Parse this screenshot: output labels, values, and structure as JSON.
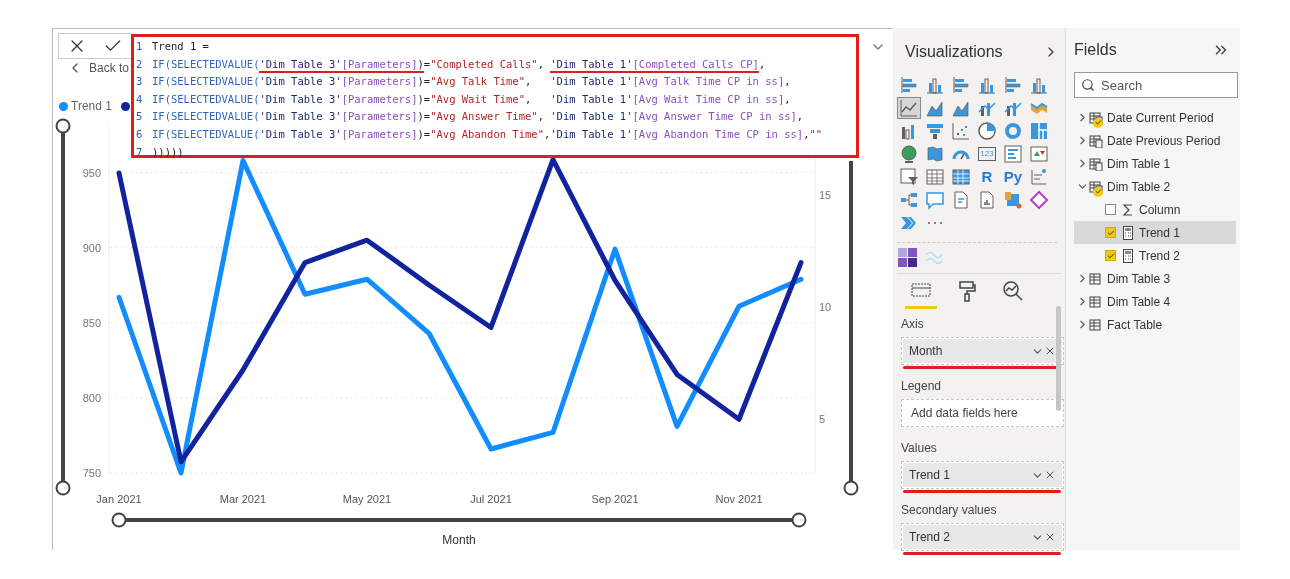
{
  "report_canvas": {
    "toolbar": {
      "back_label": "Back to"
    },
    "formula_editor": {
      "lines": [
        {
          "number": "1",
          "segments": [
            {
              "text": "Trend 1 =",
              "kind": "plain",
              "underlined": false
            }
          ]
        },
        {
          "number": "2",
          "segments": [
            {
              "text": "IF(SELECTEDVALUE(",
              "kind": "function",
              "underlined": false
            },
            {
              "text": "'Dim Table 3'",
              "kind": "table",
              "underlined": true
            },
            {
              "text": "[Parameters]",
              "kind": "column",
              "underlined": true
            },
            {
              "text": ")",
              "kind": "plain",
              "underlined": true
            },
            {
              "text": "=",
              "kind": "plain",
              "underlined": false
            },
            {
              "text": "\"Completed Calls\"",
              "kind": "string",
              "underlined": false
            },
            {
              "text": ", ",
              "kind": "plain",
              "underlined": false
            },
            {
              "text": "'Dim Table 1'",
              "kind": "table",
              "underlined": true
            },
            {
              "text": "[Completed Calls CP]",
              "kind": "column",
              "underlined": true
            },
            {
              "text": ",",
              "kind": "plain",
              "underlined": false
            }
          ]
        },
        {
          "number": "3",
          "segments": [
            {
              "text": "IF(SELECTEDVALUE(",
              "kind": "function",
              "underlined": false
            },
            {
              "text": "'Dim Table 3'",
              "kind": "table",
              "underlined": false
            },
            {
              "text": "[Parameters]",
              "kind": "column",
              "underlined": false
            },
            {
              "text": ")=",
              "kind": "plain",
              "underlined": false
            },
            {
              "text": "\"Avg Talk Time\"",
              "kind": "string",
              "underlined": false
            },
            {
              "text": ",   ",
              "kind": "plain",
              "underlined": false
            },
            {
              "text": "'Dim Table 1'",
              "kind": "table",
              "underlined": false
            },
            {
              "text": "[Avg Talk Time CP in ss]",
              "kind": "column",
              "underlined": false
            },
            {
              "text": ",",
              "kind": "plain",
              "underlined": false
            }
          ]
        },
        {
          "number": "4",
          "segments": [
            {
              "text": "IF(SELECTEDVALUE(",
              "kind": "function",
              "underlined": false
            },
            {
              "text": "'Dim Table 3'",
              "kind": "table",
              "underlined": false
            },
            {
              "text": "[Parameters]",
              "kind": "column",
              "underlined": false
            },
            {
              "text": ")=",
              "kind": "plain",
              "underlined": false
            },
            {
              "text": "\"Avg Wait Time\"",
              "kind": "string",
              "underlined": false
            },
            {
              "text": ",   ",
              "kind": "plain",
              "underlined": false
            },
            {
              "text": "'Dim Table 1'",
              "kind": "table",
              "underlined": false
            },
            {
              "text": "[Avg Wait Time CP in ss]",
              "kind": "column",
              "underlined": false
            },
            {
              "text": ",",
              "kind": "plain",
              "underlined": false
            }
          ]
        },
        {
          "number": "5",
          "segments": [
            {
              "text": "IF(SELECTEDVALUE(",
              "kind": "function",
              "underlined": false
            },
            {
              "text": "'Dim Table 3'",
              "kind": "table",
              "underlined": false
            },
            {
              "text": "[Parameters]",
              "kind": "column",
              "underlined": false
            },
            {
              "text": ")=",
              "kind": "plain",
              "underlined": false
            },
            {
              "text": "\"Avg Answer Time\"",
              "kind": "string",
              "underlined": false
            },
            {
              "text": ", ",
              "kind": "plain",
              "underlined": false
            },
            {
              "text": "'Dim Table 1'",
              "kind": "table",
              "underlined": false
            },
            {
              "text": "[Avg Answer Time CP in ss]",
              "kind": "column",
              "underlined": false
            },
            {
              "text": ",",
              "kind": "plain",
              "underlined": false
            }
          ]
        },
        {
          "number": "6",
          "segments": [
            {
              "text": "IF(SELECTEDVALUE(",
              "kind": "function",
              "underlined": false
            },
            {
              "text": "'Dim Table 3'",
              "kind": "table",
              "underlined": false
            },
            {
              "text": "[Parameters]",
              "kind": "column",
              "underlined": false
            },
            {
              "text": ")=",
              "kind": "plain",
              "underlined": false
            },
            {
              "text": "\"Avg Abandon Time\"",
              "kind": "string",
              "underlined": false
            },
            {
              "text": ",",
              "kind": "plain",
              "underlined": false
            },
            {
              "text": "'Dim Table 1'",
              "kind": "table",
              "underlined": false
            },
            {
              "text": "[Avg Abandon Time CP in ss]",
              "kind": "column",
              "underlined": false
            },
            {
              "text": ",",
              "kind": "plain",
              "underlined": false
            },
            {
              "text": "\"\"",
              "kind": "string",
              "underlined": false
            }
          ]
        },
        {
          "number": "7",
          "segments": [
            {
              "text": ")))))",
              "kind": "plain",
              "underlined": false
            }
          ]
        }
      ]
    },
    "visual": {
      "chart_data": {
        "type": "line",
        "xlabel": "Month",
        "categories": [
          "Jan 2021",
          null,
          "Mar 2021",
          null,
          "May 2021",
          null,
          "Jul 2021",
          null,
          "Sep 2021",
          null,
          "Nov 2021",
          null
        ],
        "grid": true,
        "ylim": [
          750,
          981
        ],
        "yticks": [
          750,
          800,
          850,
          900,
          950
        ],
        "y2lim": [
          2.6,
          18.1
        ],
        "y2ticks": [
          5,
          10,
          15
        ],
        "series": [
          {
            "name": "Trend 1",
            "color": "#118dff",
            "values": [
              867,
              750,
              958,
              869,
              879,
              843,
              766,
              777,
              899,
              781,
              861,
              879
            ]
          },
          {
            "color": "#12239e",
            "axis": "y2",
            "values": [
              16.0,
              3.1,
              7.2,
              12.0,
              13.0,
              11.0,
              9.1,
              16.6,
              11.2,
              7.0,
              5.0,
              12.0
            ]
          }
        ]
      }
    }
  },
  "visualizations": {
    "title": "Visualizations",
    "icons": [
      {
        "kind": "hbar",
        "selected": false
      },
      {
        "kind": "col",
        "selected": false
      },
      {
        "kind": "hbar",
        "selected": false
      },
      {
        "kind": "col",
        "selected": false
      },
      {
        "kind": "hbar",
        "selected": false
      },
      {
        "kind": "col",
        "selected": false
      },
      {
        "kind": "line",
        "selected": true
      },
      {
        "kind": "area",
        "selected": false
      },
      {
        "kind": "area",
        "selected": false
      },
      {
        "kind": "combo",
        "selected": false
      },
      {
        "kind": "combo",
        "selected": false
      },
      {
        "kind": "ribbon",
        "selected": false
      },
      {
        "kind": "waterfall",
        "selected": false
      },
      {
        "kind": "funnel",
        "selected": false
      },
      {
        "kind": "scatter",
        "selected": false
      },
      {
        "kind": "pie",
        "selected": false
      },
      {
        "kind": "donut",
        "selected": false
      },
      {
        "kind": "treemap",
        "selected": false
      },
      {
        "kind": "globe",
        "selected": false
      },
      {
        "kind": "map",
        "selected": false
      },
      {
        "kind": "gauge",
        "selected": false
      },
      {
        "kind": "card",
        "label": "123",
        "selected": false
      },
      {
        "kind": "multicard",
        "selected": false
      },
      {
        "kind": "kpi",
        "selected": false
      },
      {
        "kind": "slicer",
        "selected": false
      },
      {
        "kind": "table",
        "selected": false
      },
      {
        "kind": "matrix",
        "selected": false
      },
      {
        "kind": "text",
        "label": "R",
        "selected": false
      },
      {
        "kind": "text",
        "label": "Py",
        "selected": false
      },
      {
        "kind": "influencers",
        "selected": false
      },
      {
        "kind": "tree",
        "selected": false
      },
      {
        "kind": "speech",
        "selected": false
      },
      {
        "kind": "doc",
        "selected": false
      },
      {
        "kind": "report",
        "selected": false
      },
      {
        "kind": "apps",
        "selected": false
      },
      {
        "kind": "diamond",
        "selected": false
      },
      {
        "kind": "chevrons",
        "selected": false
      },
      {
        "kind": "more",
        "selected": false
      }
    ],
    "custom_icons": [
      {
        "kind": "tiles"
      },
      {
        "kind": "wave"
      }
    ],
    "tabs": [
      {
        "kind": "fields",
        "selected": true
      },
      {
        "kind": "format",
        "selected": false
      },
      {
        "kind": "analytics",
        "selected": false
      }
    ],
    "wells": [
      {
        "label": "Axis",
        "value": "Month",
        "highlighted": true
      },
      {
        "label": "Legend",
        "placeholder": "Add data fields here",
        "highlighted": false
      },
      {
        "label": "Values",
        "value": "Trend 1",
        "highlighted": true
      },
      {
        "label": "Secondary values",
        "value": "Trend 2",
        "highlighted": true
      }
    ]
  },
  "fields": {
    "title": "Fields",
    "search": {
      "placeholder": "Search"
    },
    "tree": [
      {
        "label": "Date Current Period",
        "kind": "calc-table",
        "in_use": true,
        "expanded": false,
        "selected": false
      },
      {
        "label": "Date Previous Period",
        "kind": "calc-table",
        "in_use": false,
        "expanded": false,
        "selected": false
      },
      {
        "label": "Dim Table 1",
        "kind": "calc-table",
        "in_use": false,
        "expanded": false,
        "selected": false
      },
      {
        "label": "Dim Table 2",
        "kind": "calc-table",
        "in_use": true,
        "expanded": true,
        "selected": false,
        "children": [
          {
            "label": "Column",
            "kind": "sum",
            "checked": false,
            "selected": false
          },
          {
            "label": "Trend 1",
            "kind": "measure",
            "checked": true,
            "selected": true
          },
          {
            "label": "Trend 2",
            "kind": "measure",
            "checked": true,
            "selected": false
          }
        ]
      },
      {
        "label": "Dim Table 3",
        "kind": "table",
        "in_use": false,
        "expanded": false,
        "selected": false
      },
      {
        "label": "Dim Table 4",
        "kind": "table",
        "in_use": false,
        "expanded": false,
        "selected": false
      },
      {
        "label": "Fact Table",
        "kind": "table",
        "in_use": false,
        "expanded": false,
        "selected": false
      }
    ]
  }
}
